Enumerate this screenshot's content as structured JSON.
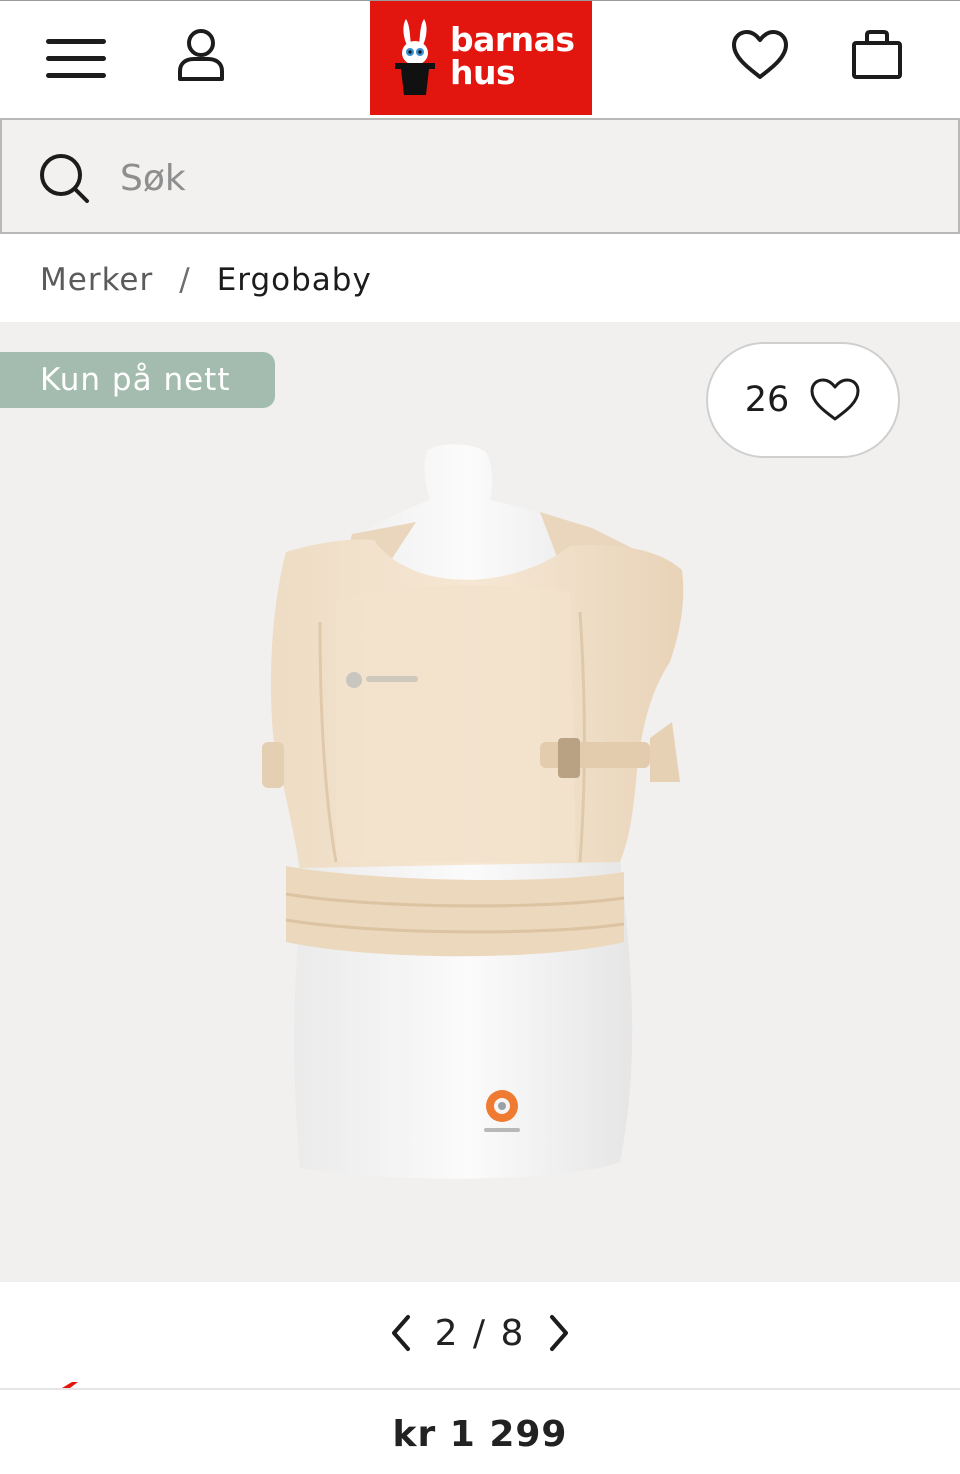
{
  "header": {
    "logo_line1": "barnas",
    "logo_line2": "hus",
    "brand_color": "#e3150f"
  },
  "search": {
    "placeholder": "Søk",
    "value": ""
  },
  "breadcrumb": {
    "items": [
      "Merker",
      "Ergobaby"
    ],
    "separator": "/"
  },
  "gallery": {
    "badge": "Kun på nett",
    "badge_color": "#a4bcb0",
    "favorites_count": "26",
    "current": "2",
    "total": "8",
    "separator": "/"
  },
  "product": {
    "price": "kr 1 299"
  },
  "icons": [
    "menu-icon",
    "user-icon",
    "heart-icon",
    "bag-icon",
    "search-icon",
    "chevron-left-icon",
    "chevron-right-icon"
  ]
}
